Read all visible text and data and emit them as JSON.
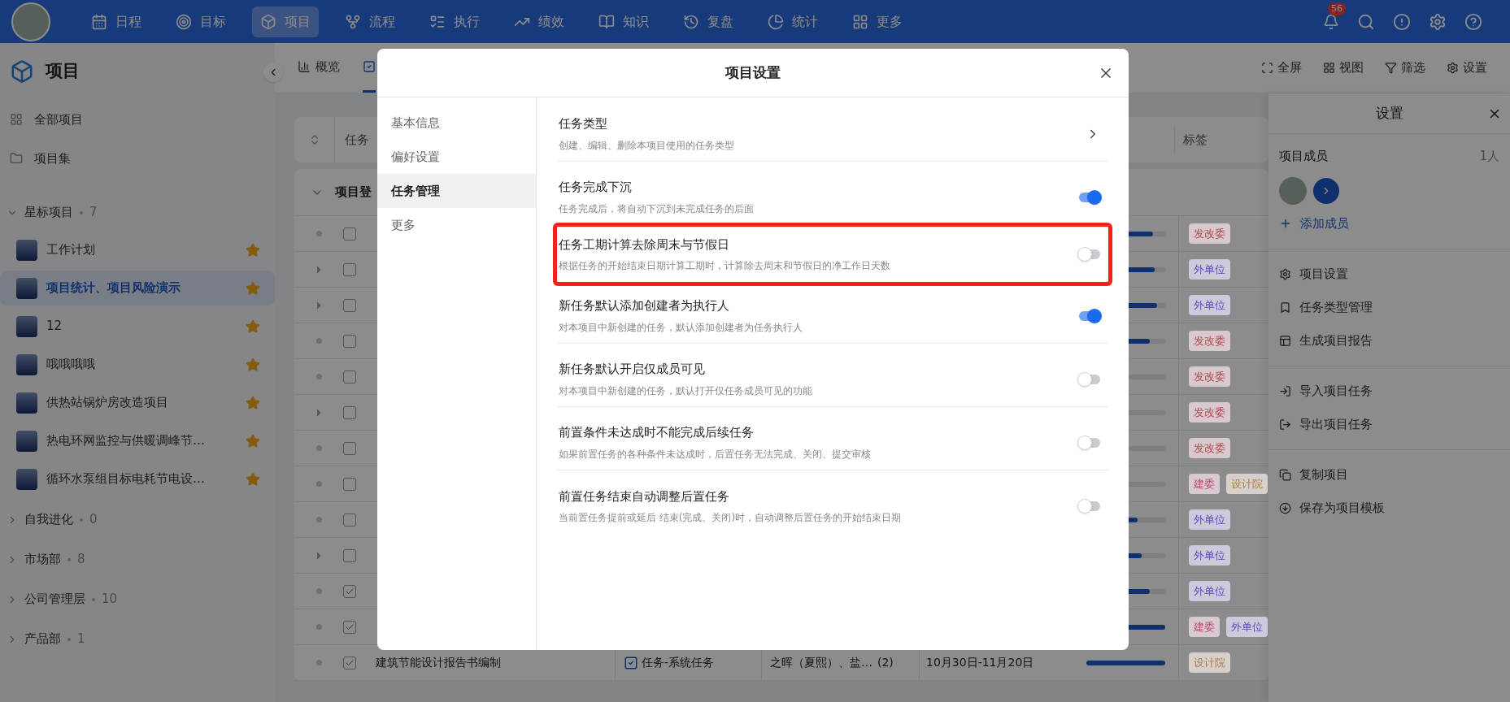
{
  "nav": {
    "items": [
      {
        "label": "日程",
        "selected": false
      },
      {
        "label": "目标",
        "selected": false
      },
      {
        "label": "项目",
        "selected": true
      },
      {
        "label": "流程",
        "selected": false
      },
      {
        "label": "执行",
        "selected": false
      },
      {
        "label": "绩效",
        "selected": false
      },
      {
        "label": "知识",
        "selected": false
      },
      {
        "label": "复盘",
        "selected": false
      },
      {
        "label": "统计",
        "selected": false
      },
      {
        "label": "更多",
        "selected": false
      }
    ],
    "badge": "56"
  },
  "sidebar": {
    "title": "项目",
    "links": [
      "全部项目",
      "项目集"
    ],
    "groups": [
      {
        "label": "星标项目",
        "count": "7",
        "expanded": true,
        "children": [
          {
            "label": "工作计划",
            "selected": false
          },
          {
            "label": "项目统计、项目风险演示",
            "selected": true
          },
          {
            "label": "12",
            "selected": false
          },
          {
            "label": "哦哦哦哦",
            "selected": false
          },
          {
            "label": "供热站锅炉房改造项目",
            "selected": false
          },
          {
            "label": "热电环网监控与供暖调峰节…",
            "selected": false
          },
          {
            "label": "循环水泵组目标电耗节电设…",
            "selected": false
          }
        ]
      },
      {
        "label": "自我进化",
        "count": "0",
        "expanded": false
      },
      {
        "label": "市场部",
        "count": "8",
        "expanded": false
      },
      {
        "label": "公司管理层",
        "count": "10",
        "expanded": false
      },
      {
        "label": "产品部",
        "count": "1",
        "expanded": false
      }
    ]
  },
  "tabs": [
    {
      "label": "概览",
      "selected": false
    },
    {
      "selected": true
    }
  ],
  "actions": [
    "全屏",
    "视图",
    "筛选",
    "设置"
  ],
  "table": {
    "columns": [
      "任务",
      "标签"
    ],
    "group": "项目登",
    "rows": [
      {
        "kind": "leaf",
        "checked": false,
        "level": 0.85,
        "tags": [
          {
            "text": "发改委",
            "color": "#b8444a"
          }
        ]
      },
      {
        "kind": "parent",
        "checked": false,
        "level": 0.87,
        "tags": [
          {
            "text": "外单位",
            "color": "#5a4db0"
          }
        ]
      },
      {
        "kind": "parent",
        "checked": false,
        "level": 0.9,
        "tags": [
          {
            "text": "外单位",
            "color": "#5a4db0"
          }
        ]
      },
      {
        "kind": "leaf",
        "checked": false,
        "level": 0.8,
        "tags": [
          {
            "text": "发改委",
            "color": "#b8444a"
          }
        ]
      },
      {
        "kind": "leaf",
        "checked": false,
        "level": 0.0,
        "tags": [
          {
            "text": "发改委",
            "color": "#b8444a"
          }
        ]
      },
      {
        "kind": "parent",
        "checked": false,
        "level": 0.0,
        "tags": [
          {
            "text": "发改委",
            "color": "#b8444a"
          }
        ]
      },
      {
        "kind": "leaf",
        "checked": false,
        "level": 0.05,
        "tags": [
          {
            "text": "发改委",
            "color": "#b8444a"
          }
        ]
      },
      {
        "kind": "leaf",
        "checked": false,
        "level": 0.3,
        "tags": [
          {
            "text": "建委",
            "color": "#b84a70"
          },
          {
            "text": "设计院",
            "color": "#b07a3a"
          }
        ]
      },
      {
        "kind": "leaf",
        "checked": false,
        "level": 0.65,
        "tags": [
          {
            "text": "外单位",
            "color": "#5a4db0"
          }
        ]
      },
      {
        "kind": "parent",
        "checked": false,
        "level": 0.7,
        "tags": [
          {
            "text": "外单位",
            "color": "#5a4db0"
          }
        ]
      },
      {
        "kind": "leaf",
        "checked": true,
        "level": 0.8,
        "tags": [
          {
            "text": "外单位",
            "color": "#5a4db0"
          }
        ]
      },
      {
        "kind": "leaf",
        "checked": true,
        "level": 1.0,
        "tags": [
          {
            "text": "建委",
            "color": "#b84a70"
          },
          {
            "text": "外单位",
            "color": "#5a4db0"
          }
        ]
      },
      {
        "kind": "leaf",
        "checked": true,
        "name": "建筑节能设计报告书编制",
        "type": "任务-系统任务",
        "assignee": "之晖（夏熙）、盐…",
        "count": "(2)",
        "date": "10月30日-11月20日",
        "level": 1.0,
        "tags": [
          {
            "text": "设计院",
            "color": "#b07a3a"
          }
        ]
      }
    ]
  },
  "panel": {
    "title": "设置",
    "members_label": "项目成员",
    "members_count": "1人",
    "add_member": "添加成员",
    "menu": [
      [
        "项目设置",
        "任务类型管理",
        "生成项目报告"
      ],
      [
        "导入项目任务",
        "导出项目任务"
      ],
      [
        "复制项目",
        "保存为项目模板"
      ]
    ]
  },
  "modal": {
    "title": "项目设置",
    "nav": [
      {
        "label": "基本信息",
        "selected": false
      },
      {
        "label": "偏好设置",
        "selected": false
      },
      {
        "label": "任务管理",
        "selected": true
      },
      {
        "label": "更多",
        "selected": false
      }
    ],
    "settings": [
      {
        "kind": "link",
        "title": "任务类型",
        "desc": "创建、编辑、删除本项目使用的任务类型",
        "highlighted": false
      },
      {
        "kind": "toggle",
        "title": "任务完成下沉",
        "desc": "任务完成后，将自动下沉到未完成任务的后面",
        "on": true,
        "highlighted": false
      },
      {
        "kind": "toggle",
        "title": "任务工期计算去除周末与节假日",
        "desc": "根据任务的开始结束日期计算工期时，计算除去周末和节假日的净工作日天数",
        "on": false,
        "highlighted": true
      },
      {
        "kind": "toggle",
        "title": "新任务默认添加创建者为执行人",
        "desc": "对本项目中新创建的任务，默认添加创建者为任务执行人",
        "on": true,
        "highlighted": false
      },
      {
        "kind": "toggle",
        "title": "新任务默认开启仅成员可见",
        "desc": "对本项目中新创建的任务，默认打开仅任务成员可见的功能",
        "on": false,
        "highlighted": false
      },
      {
        "kind": "toggle",
        "title": "前置条件未达成时不能完成后续任务",
        "desc": "如果前置任务的各种条件未达成时，后置任务无法完成、关闭、提交审核",
        "on": false,
        "highlighted": false
      },
      {
        "kind": "toggle",
        "title": "前置任务结束自动调整后置任务",
        "desc": "当前置任务提前或延后 结束(完成、关闭)时，自动调整后置任务的开始结束日期",
        "on": false,
        "highlighted": false
      }
    ]
  }
}
